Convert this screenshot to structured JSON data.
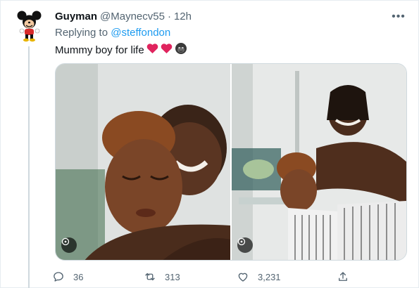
{
  "tweet": {
    "display_name": "Guyman",
    "handle": "@Maynecv55",
    "separator": "·",
    "time": "12h",
    "replying_prefix": "Replying to",
    "replying_to": "@steffondon",
    "text": "Mummy boy for life",
    "emojis": [
      "red-heart",
      "red-heart",
      "gorilla"
    ],
    "more_label": "•••"
  },
  "actions": {
    "replies": "36",
    "retweets": "313",
    "likes": "3,231"
  },
  "colors": {
    "link": "#1d9bf0",
    "secondary_text": "#536471",
    "primary_text": "#0f1419"
  }
}
